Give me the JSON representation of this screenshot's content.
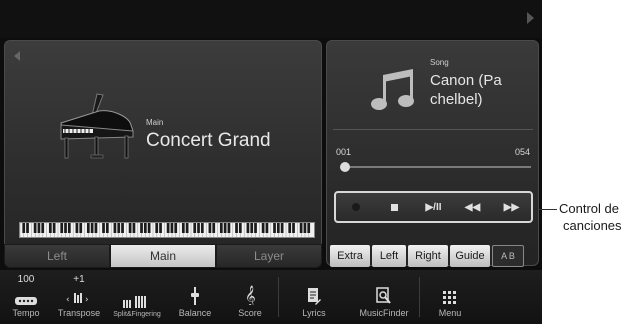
{
  "voice": {
    "section_label": "Main",
    "name": "Concert Grand",
    "part_tabs": [
      {
        "label": "Left",
        "active": false
      },
      {
        "label": "Main",
        "active": true
      },
      {
        "label": "Layer",
        "active": false
      }
    ]
  },
  "song": {
    "label": "Song",
    "name_line1": "Canon (Pa",
    "name_line2": "chelbel)",
    "bar_start": "001",
    "bar_end": "054",
    "progress": 0.02,
    "controls": {
      "record_icon": "record-icon",
      "stop_icon": "stop-icon",
      "play_pause": "▶/II",
      "rewind": "◀◀",
      "fast_forward": "▶▶"
    },
    "util_buttons": [
      "Extra",
      "Left",
      "Right",
      "Guide"
    ],
    "ab_button": "A B"
  },
  "bottom_bar": {
    "tempo_value": "100",
    "tempo": "Tempo",
    "transpose_value": "+1",
    "transpose": "Transpose",
    "split": "Split&Fingering",
    "balance": "Balance",
    "score": "Score",
    "lyrics": "Lyrics",
    "musicfinder": "MusicFinder",
    "menu": "Menu"
  },
  "callout": {
    "line1": "Control de",
    "line2": "canciones"
  },
  "colors": {
    "panel": "#2e2e2e",
    "active_tab": "#d8d8d8",
    "text": "#e8e8e8"
  }
}
